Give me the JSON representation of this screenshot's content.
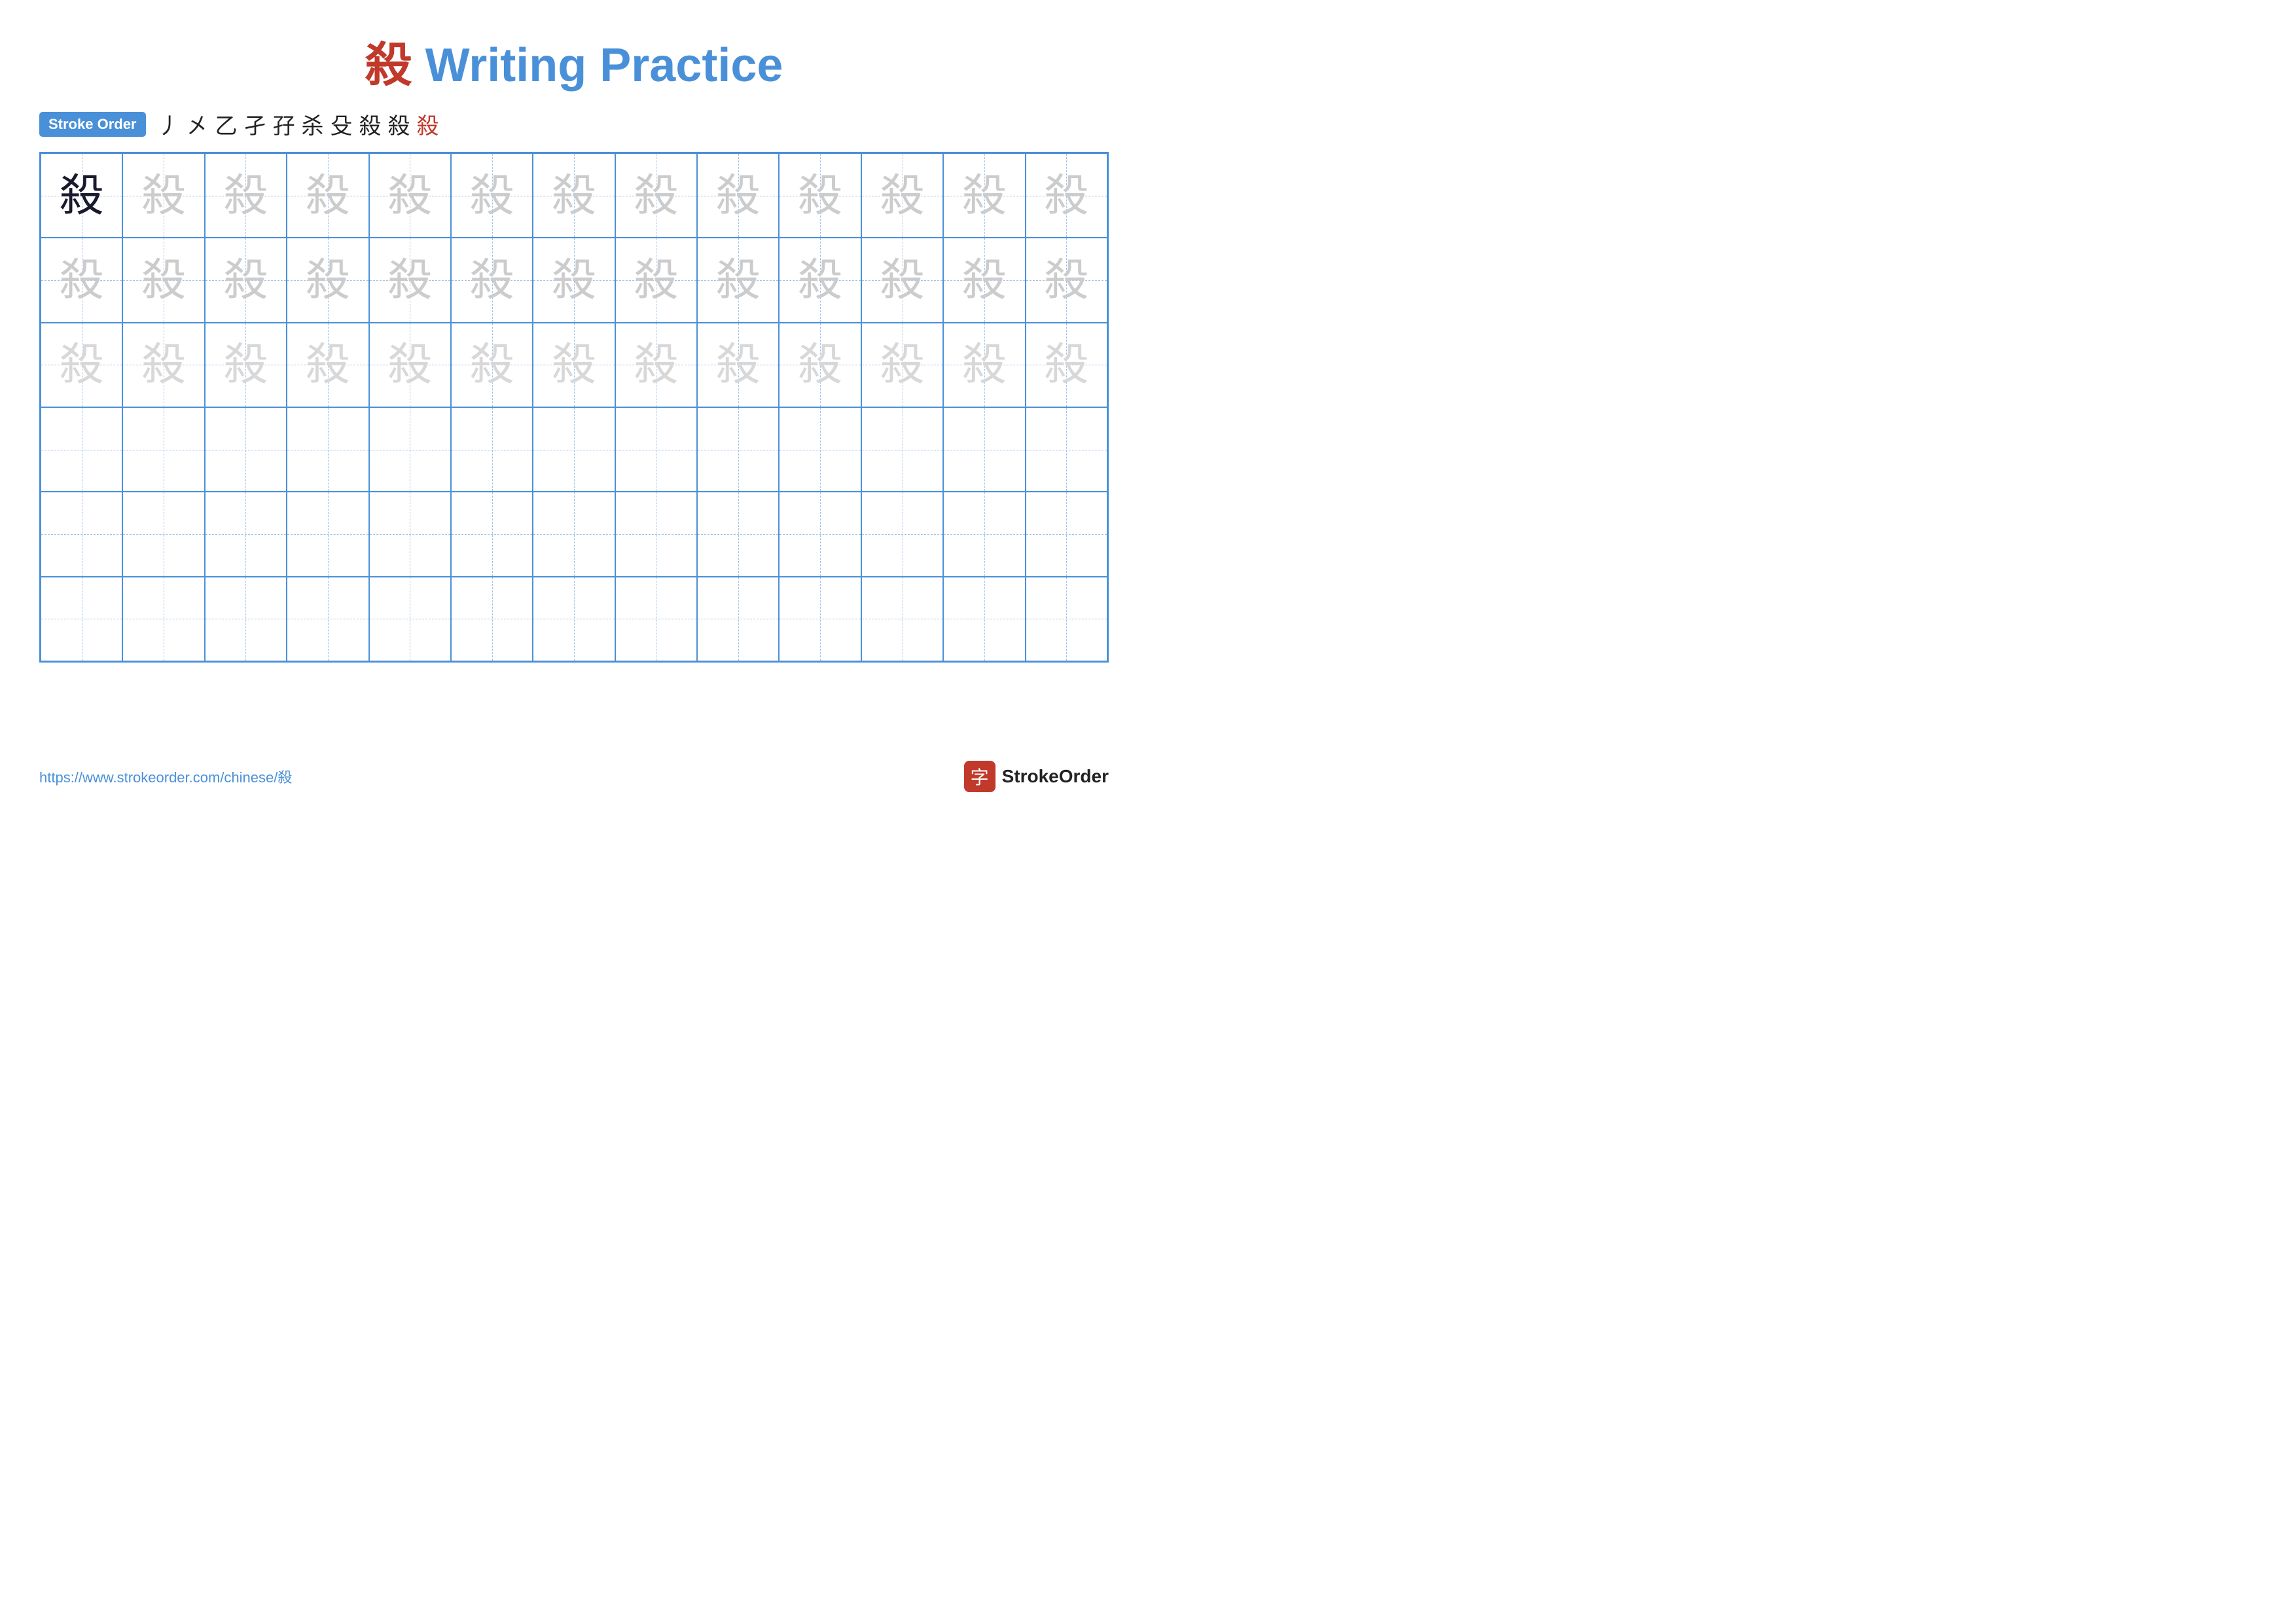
{
  "title": {
    "char": "殺",
    "text": " Writing Practice"
  },
  "stroke_order": {
    "badge_label": "Stroke Order",
    "steps": [
      "丿",
      "㐅",
      "乙",
      "孑",
      "孑",
      "杀",
      "殳",
      "殳",
      "殺",
      "殺"
    ]
  },
  "grid": {
    "rows": 6,
    "cols": 13,
    "char": "殺",
    "row_types": [
      "dark_first",
      "light",
      "lighter",
      "empty",
      "empty",
      "empty"
    ]
  },
  "footer": {
    "url": "https://www.strokeorder.com/chinese/殺",
    "logo_char": "字",
    "logo_text": "StrokeOrder"
  }
}
